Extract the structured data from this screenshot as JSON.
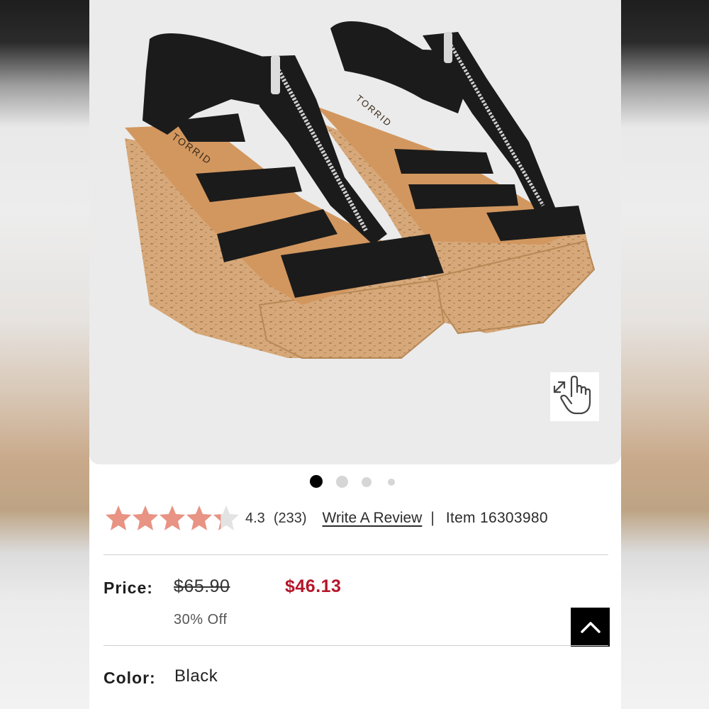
{
  "product": {
    "image_alt": "Black zip-front cork wedge sandals",
    "brand_stamp": "TORRID"
  },
  "carousel": {
    "total": 4,
    "active_index": 0
  },
  "rating": {
    "value": 4.3,
    "value_label": "4.3",
    "count_label": "(233)",
    "star_color": "#e89383",
    "empty_star_color": "#e3e3e3",
    "write_review_label": "Write A Review",
    "separator": "|",
    "item_label": "Item 16303980"
  },
  "price": {
    "label": "Price:",
    "original": "$65.90",
    "sale": "$46.13",
    "sale_color": "#b5162a",
    "discount": "30% Off"
  },
  "color": {
    "label": "Color:",
    "value": "Black"
  },
  "icons": {
    "zoom": "zoom-hand-icon",
    "back_to_top": "chevron-up-icon"
  }
}
